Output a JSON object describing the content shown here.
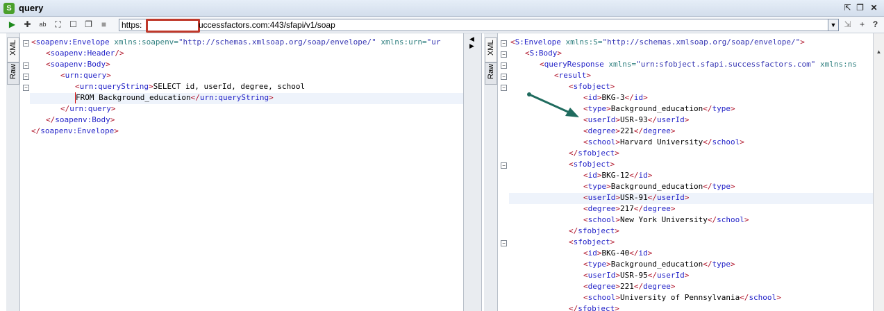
{
  "window": {
    "title": "query",
    "app_icon_label": "S"
  },
  "toolbar": {
    "url_prefix": "https:",
    "url_suffix": "uccessfactors.com:443/sfapi/v1/soap",
    "icons": [
      "run-icon",
      "add-endpoint-icon",
      "auth-icon",
      "fit-icon",
      "new-window-icon",
      "copy-icon",
      "stop-icon",
      "url-dropdown-icon",
      "wsdl-icon",
      "add-icon",
      "help-icon"
    ]
  },
  "left_tabs": {
    "xml": "XML",
    "raw": "Raw"
  },
  "right_tabs": {
    "xml": "XML",
    "raw": "Raw"
  },
  "request": {
    "l1": {
      "a": "<",
      "b": "soapenv:Envelope",
      "c": " xmlns:soapenv=",
      "d": "\"http://schemas.xmlsoap.org/soap/envelope/\"",
      "e": " xmlns:urn=",
      "f": "\"ur"
    },
    "l2": {
      "a": "<",
      "b": "soapenv:Header",
      "c": "/>"
    },
    "l3": {
      "a": "<",
      "b": "soapenv:Body",
      "c": ">"
    },
    "l4": {
      "a": "<",
      "b": "urn:query",
      "c": ">"
    },
    "l5": {
      "a": "<",
      "b": "urn:queryString",
      "c": ">",
      "d": "SELECT id, userId, degree, school"
    },
    "l6": {
      "a": "FROM Background_education",
      "b": "</",
      "c": "urn:queryString",
      "d": ">"
    },
    "l7": {
      "a": "</",
      "b": "urn:query",
      "c": ">"
    },
    "l8": {
      "a": "</",
      "b": "soapenv:Body",
      "c": ">"
    },
    "l9": {
      "a": "</",
      "b": "soapenv:Envelope",
      "c": ">"
    }
  },
  "response": {
    "l1": {
      "a": "<",
      "b": "S:Envelope",
      "c": " xmlns:S=",
      "d": "\"http://schemas.xmlsoap.org/soap/envelope/\"",
      "e": ">"
    },
    "l2": {
      "a": "<",
      "b": "S:Body",
      "c": ">"
    },
    "l3": {
      "a": "<",
      "b": "queryResponse",
      "c": " xmlns=",
      "d": "\"urn:sfobject.sfapi.successfactors.com\"",
      "e": " xmlns:ns"
    },
    "l4": {
      "a": "<",
      "b": "result",
      "c": ">"
    },
    "records": [
      {
        "id": "BKG-3",
        "type": "Background_education",
        "userId": "USR-93",
        "degree": "221",
        "school": "Harvard University"
      },
      {
        "id": "BKG-12",
        "type": "Background_education",
        "userId": "USR-91",
        "degree": "217",
        "school": "New York University"
      },
      {
        "id": "BKG-40",
        "type": "Background_education",
        "userId": "USR-95",
        "degree": "221",
        "school": "University of Pennsylvania"
      }
    ],
    "tags": {
      "sfobject": "sfobject",
      "id": "id",
      "type": "type",
      "userId": "userId",
      "degree": "degree",
      "school": "school"
    }
  },
  "colors": {
    "tag": "#2424c8",
    "bracket": "#b0152a",
    "attr": "#2f7f7f",
    "arrow": "#1f6b5e"
  }
}
